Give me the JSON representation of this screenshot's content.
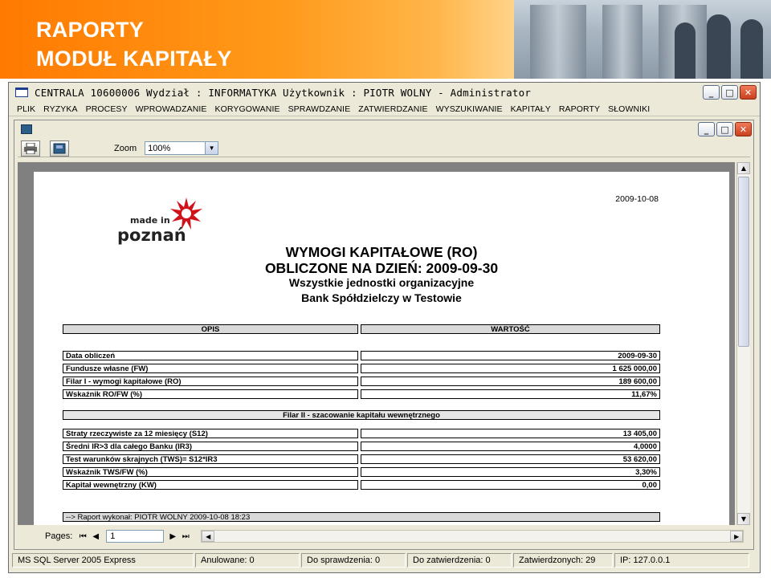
{
  "slide": {
    "title_line1": "RAPORTY",
    "title_line2": "MODUŁ KAPITAŁY"
  },
  "app": {
    "title": "CENTRALA   10600006   Wydział : INFORMATYKA    Użytkownik : PIOTR WOLNY - Administrator",
    "menu": [
      "PLIK",
      "RYZYKA",
      "PROCESY",
      "WPROWADZANIE",
      "KORYGOWANIE",
      "SPRAWDZANIE",
      "ZATWIERDZANIE",
      "WYSZUKIWANIE",
      "KAPITAŁY",
      "RAPORTY",
      "SŁOWNIKI"
    ]
  },
  "viewer": {
    "zoom_label": "Zoom",
    "zoom_value": "100%",
    "pages_label": "Pages:",
    "page_value": "1"
  },
  "report": {
    "date": "2009-10-08",
    "logo_text_top": "made in",
    "logo_text_bottom": "poznań",
    "title1": "WYMOGI KAPITAŁOWE (RO)",
    "title2": "OBLICZONE NA DZIEŃ: 2009-09-30",
    "subtitle1": "Wszystkie jednostki organizacyjne",
    "subtitle2": "Bank Spółdzielczy w Testowie",
    "col_opis": "OPIS",
    "col_wartosc": "WARTOŚĆ",
    "rows1": [
      {
        "label": "Data obliczeń",
        "value": "2009-09-30"
      },
      {
        "label": "Fundusze własne (FW)",
        "value": "1 625 000,00"
      },
      {
        "label": "Filar I - wymogi kapitałowe (RO)",
        "value": "189 600,00"
      },
      {
        "label": "Wskaźnik RO/FW (%)",
        "value": "11,67%"
      }
    ],
    "section2": "Filar II - szacowanie kapitału wewnętrznego",
    "rows2": [
      {
        "label": "Straty rzeczywiste za  12 miesięcy (S12)",
        "value": "13 405,00"
      },
      {
        "label": "Średni IR>3 dla całego Banku  (IR3)",
        "value": "4,0000"
      },
      {
        "label": "Test warunków skrajnych (TWS)= S12*IR3",
        "value": "53 620,00"
      },
      {
        "label": "Wskaźnik TWS/FW (%)",
        "value": "3,30%"
      },
      {
        "label": "Kapitał wewnętrzny (KW)",
        "value": "0,00"
      }
    ],
    "footer": "--> Raport wykonał: PIOTR WOLNY 2009-10-08 18:23"
  },
  "status": [
    "MS SQL Server 2005 Express",
    "Anulowane: 0",
    "Do sprawdzenia: 0",
    "Do zatwierdzenia: 0",
    "Zatwierdzonych: 29",
    "IP: 127.0.0.1"
  ],
  "colors": {
    "banner_orange": "#ff8c00",
    "window_bg": "#ece9d8",
    "logo_red": "#d0121b"
  },
  "icons": [
    "printer-icon",
    "export-icon",
    "first-page-icon",
    "prev-page-icon",
    "next-page-icon",
    "last-page-icon"
  ]
}
